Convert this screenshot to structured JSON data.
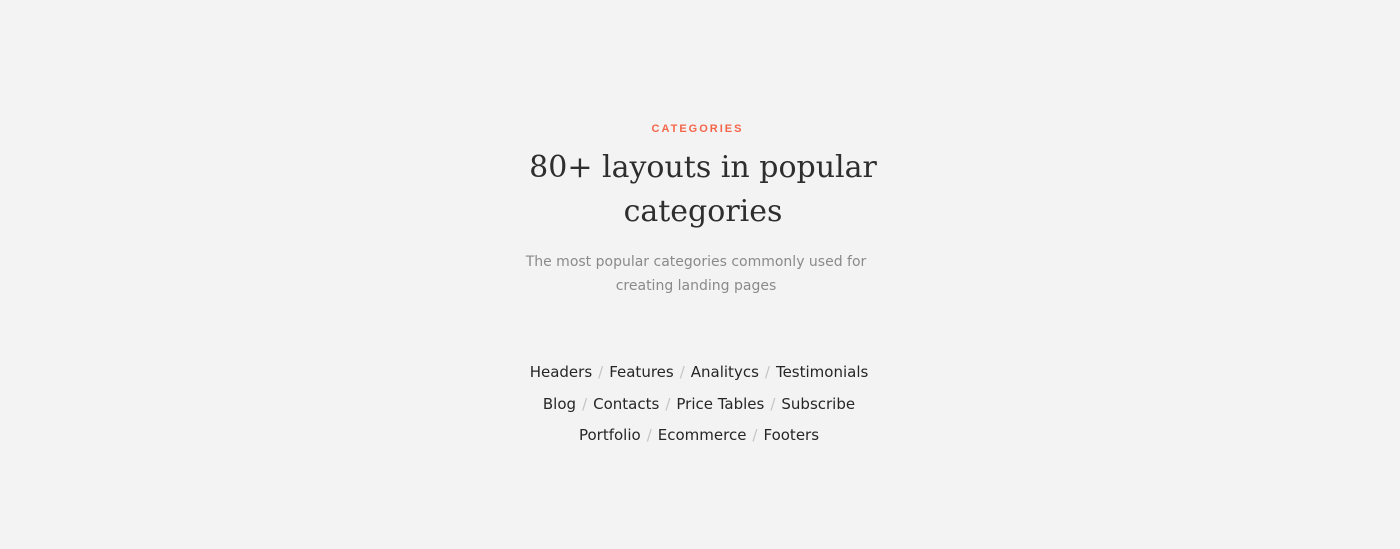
{
  "section": {
    "eyebrow": "CATEGORIES",
    "title": "80+ layouts in popular categories",
    "subtitle": "The most popular categories commonly used for creating landing pages",
    "separator": "/",
    "accent_color": "#f4664a",
    "category_rows": [
      [
        "Headers",
        "Features",
        "Analitycs",
        "Testimonials"
      ],
      [
        "Blog",
        "Contacts",
        "Price Tables",
        "Subscribe"
      ],
      [
        "Portfolio",
        "Ecommerce",
        "Footers"
      ]
    ]
  }
}
